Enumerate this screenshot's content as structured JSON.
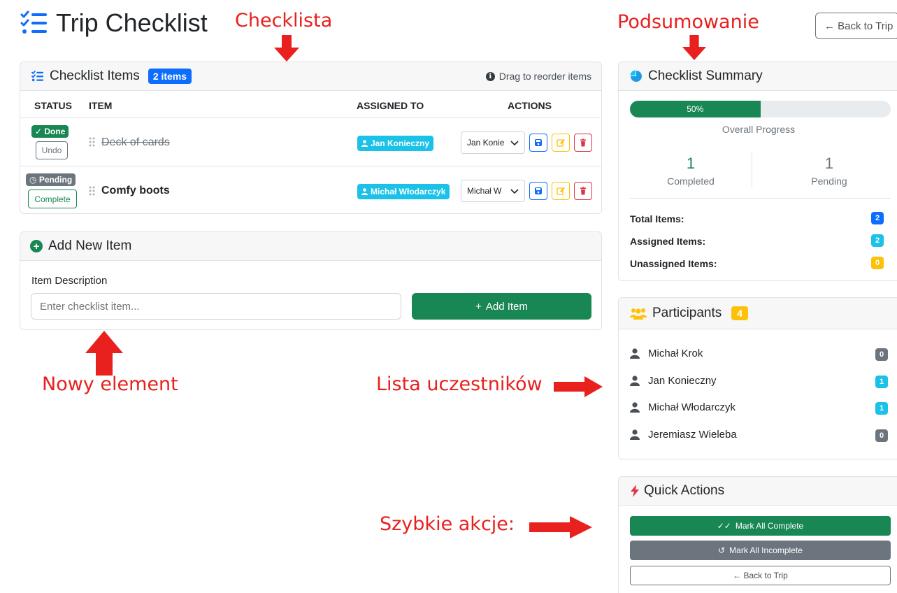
{
  "page": {
    "title": "Trip Checklist",
    "back_label": "← Back to Trip"
  },
  "annotations": {
    "checklista": "Checklista",
    "podsumowanie": "Podsumowanie",
    "nowy_element": "Nowy element",
    "lista_uczestnikow": "Lista uczestników",
    "szybkie_akcje": "Szybkie akcje:"
  },
  "checklist": {
    "title": "Checklist Items",
    "count_badge": "2 items",
    "drag_hint": "Drag to reorder items",
    "columns": [
      "STATUS",
      "ITEM",
      "ASSIGNED TO",
      "ACTIONS"
    ],
    "items": [
      {
        "status": "Done",
        "status_icon": "check-icon",
        "toggle_label": "Undo",
        "text": "Deck of cards",
        "completed": true,
        "assignee": "Jan Konieczny",
        "select_value": "Jan Konie"
      },
      {
        "status": "Pending",
        "status_icon": "clock-icon",
        "toggle_label": "Complete",
        "text": "Comfy boots",
        "completed": false,
        "assignee": "Michał Włodarczyk",
        "select_value": "Michał W"
      }
    ]
  },
  "add_item": {
    "title": "Add New Item",
    "field_label": "Item Description",
    "placeholder": "Enter checklist item...",
    "button": "Add Item"
  },
  "summary": {
    "title": "Checklist Summary",
    "progress_percent": 50,
    "progress_label": "50%",
    "progress_caption": "Overall Progress",
    "completed_value": "1",
    "completed_label": "Completed",
    "pending_value": "1",
    "pending_label": "Pending",
    "rows": [
      {
        "label": "Total Items:",
        "value": "2",
        "color": "#0d6efd"
      },
      {
        "label": "Assigned Items:",
        "value": "2",
        "color": "#1bc2e8"
      },
      {
        "label": "Unassigned Items:",
        "value": "0",
        "color": "#ffc107"
      }
    ]
  },
  "participants": {
    "title": "Participants",
    "count": "4",
    "list": [
      {
        "name": "Michał Krok",
        "count": "0",
        "color": "#6c757d"
      },
      {
        "name": "Jan Konieczny",
        "count": "1",
        "color": "#1bc2e8"
      },
      {
        "name": "Michał Włodarczyk",
        "count": "1",
        "color": "#1bc2e8"
      },
      {
        "name": "Jeremiasz Wieleba",
        "count": "0",
        "color": "#6c757d"
      }
    ]
  },
  "quick_actions": {
    "title": "Quick Actions",
    "mark_all_complete": "Mark All Complete",
    "mark_all_incomplete": "Mark All Incomplete",
    "back_to_trip": "← Back to Trip"
  },
  "colors": {
    "success": "#198754",
    "primary": "#0d6efd",
    "info": "#1bc2e8",
    "warning": "#ffc107",
    "danger": "#dc3545",
    "secondary": "#6c757d",
    "annotation_red": "#e8201e"
  }
}
